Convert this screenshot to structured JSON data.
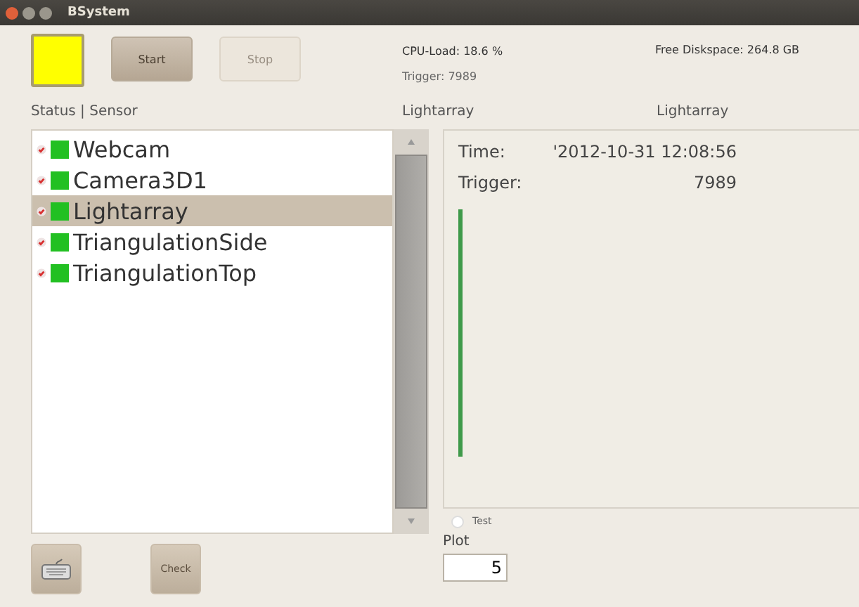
{
  "window": {
    "title": "BSystem"
  },
  "toolbar": {
    "status_light": {
      "color": "#ffff00"
    },
    "buttons": [
      {
        "label": "Start",
        "disabled": false
      },
      {
        "label": "Stop",
        "disabled": true
      }
    ]
  },
  "info": {
    "cpu_load": "CPU-Load: 18.6 %",
    "free_diskspace": "Free Diskspace: 264.8 GB",
    "trigger": "Trigger: 7989"
  },
  "headers": [
    "Status | Sensor",
    "Lightarray",
    "Lightarray"
  ],
  "sensors": [
    {
      "name": "Webcam",
      "color": "#22c022",
      "selected": false
    },
    {
      "name": "Camera3D1",
      "color": "#22c022",
      "selected": false
    },
    {
      "name": "Lightarray",
      "color": "#22c022",
      "selected": true
    },
    {
      "name": "TriangulationSide",
      "color": "#22c022",
      "selected": false
    },
    {
      "name": "TriangulationTop",
      "color": "#22c022",
      "selected": false
    }
  ],
  "detail": {
    "time_label": "Time:",
    "time_value": "'2012-10-31 12:08:56",
    "trigger_label": "Trigger:",
    "trigger_value": "7989"
  },
  "test_option": {
    "label": "Test",
    "checked": false
  },
  "plot": {
    "label": "Plot",
    "value": "5"
  },
  "bottom_buttons": [
    {
      "kind": "keyboard"
    },
    {
      "kind": "text",
      "label": "Check"
    }
  ]
}
